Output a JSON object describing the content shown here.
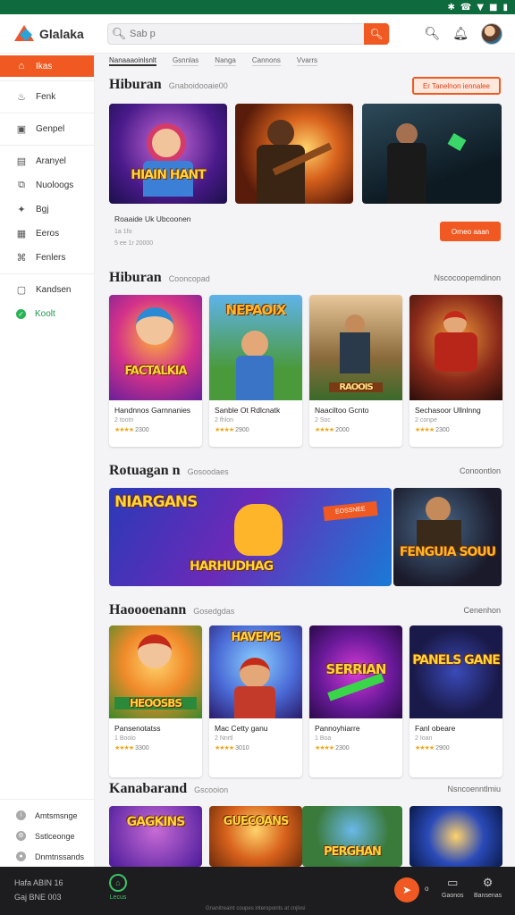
{
  "status": {
    "icons": [
      "✱",
      "☎",
      "▼",
      "■",
      "▮"
    ]
  },
  "app": {
    "name": "Glalaka"
  },
  "search": {
    "placeholder": "Sab p"
  },
  "sidebar": {
    "items": [
      {
        "label": "Ikas",
        "icon": "home-icon",
        "glyph": "⌂"
      },
      {
        "label": "Fenk",
        "icon": "flame-icon",
        "glyph": "♨"
      },
      {
        "label": "Genpel",
        "icon": "clipboard-icon",
        "glyph": "▣"
      },
      {
        "label": "Aranyel",
        "icon": "document-icon",
        "glyph": "▤"
      },
      {
        "label": "Nuoloogs",
        "icon": "copy-icon",
        "glyph": "⧉"
      },
      {
        "label": "Bgj",
        "icon": "puzzle-icon",
        "glyph": "✦"
      },
      {
        "label": "Eeros",
        "icon": "grid-icon",
        "glyph": "▦"
      },
      {
        "label": "Fenlers",
        "icon": "gamepad-icon",
        "glyph": "⌘"
      },
      {
        "label": "Kandsen",
        "icon": "box-icon",
        "glyph": "▢"
      },
      {
        "label": "Koolt",
        "icon": "green-dot-icon",
        "glyph": "✓"
      }
    ],
    "bottom": [
      {
        "label": "Amtsmsnge",
        "icon": "info-icon"
      },
      {
        "label": "Sstlceonge",
        "icon": "settings-icon"
      },
      {
        "label": "Dnmtnssands",
        "icon": "user-icon"
      }
    ]
  },
  "tabs": [
    "Nanaaaoinlsnlt",
    "Gsnnlas",
    "Nanga",
    "Cannons",
    "Vvarrs"
  ],
  "sections": {
    "s1": {
      "title": "Hiburan",
      "sub": "Gnaboidooaie00",
      "button": "Er Tanelnon iennalee",
      "featured_title": "Roaaide Uk Ubcoonen",
      "featured_sub": "1a 1fo",
      "featured_meta": "5 ee 1r 20000",
      "cta": "Orneo aaan",
      "tile_text": "HIAIN HANT"
    },
    "s2": {
      "title": "Hiburan",
      "sub": "Cooncopad",
      "link": "Nscocoopemdinon",
      "cards": [
        {
          "title": "Handnnos Garnnanies",
          "sub": "2 tootn",
          "rating": "2300",
          "art": "FACTALKIA"
        },
        {
          "title": "Sanble Ot Rdlcnatk",
          "sub": "2 fhlon",
          "rating": "2900",
          "art": "NEPAOIX"
        },
        {
          "title": "Naaciltoo Gcnto",
          "sub": "2 Soc",
          "rating": "2000",
          "art": "RAOOIS"
        },
        {
          "title": "Sechasoor Ullnlnng",
          "sub": "2 conpe",
          "rating": "2300",
          "art": ""
        }
      ]
    },
    "s3": {
      "title": "Rotuagan n",
      "sub": "Gosoodaes",
      "link": "Conoontlon",
      "banner1": "NIARGANS",
      "banner2": "HARHUDHAG",
      "banner2b": "EOSSNEE",
      "banner3": "FENGUIA SOUU"
    },
    "s4": {
      "title": "Haoooenann",
      "sub": "Gosedgdas",
      "link": "Cenenhon",
      "cards": [
        {
          "title": "Pansenotatss",
          "sub": "1 Boolo",
          "rating": "3300",
          "art": "HEOOSBS"
        },
        {
          "title": "Mac Cetty ganu",
          "sub": "2 Nnrtl",
          "rating": "3010",
          "art": "HAVEMS"
        },
        {
          "title": "Pannoyhiarre",
          "sub": "1 Boa",
          "rating": "2300",
          "art": "SERRIAN"
        },
        {
          "title": "Fanl obeare",
          "sub": "2 Ioan",
          "rating": "2900",
          "art": "PANELS GANE"
        }
      ]
    },
    "s5": {
      "title": "Kanabarand",
      "sub": "Gscooion",
      "link": "Nsncoenntlmiu",
      "cards": [
        {
          "art": "GAGKINS"
        },
        {
          "art": "GUECOANS"
        },
        {
          "art": "PERGHAN"
        },
        {
          "art": ""
        }
      ]
    }
  },
  "bottom": {
    "left_line1": "Hafa ABIN 16",
    "left_line2": "Gaj BNE 003",
    "home": "Lecus",
    "copyright": "Gnanitreaint coupes interopoints at cnjlosi",
    "icons": [
      {
        "label": "Gaonos"
      },
      {
        "label": "Bansenas"
      }
    ]
  },
  "colors": {
    "accent": "#f05a22",
    "green": "#0d6b3e"
  }
}
